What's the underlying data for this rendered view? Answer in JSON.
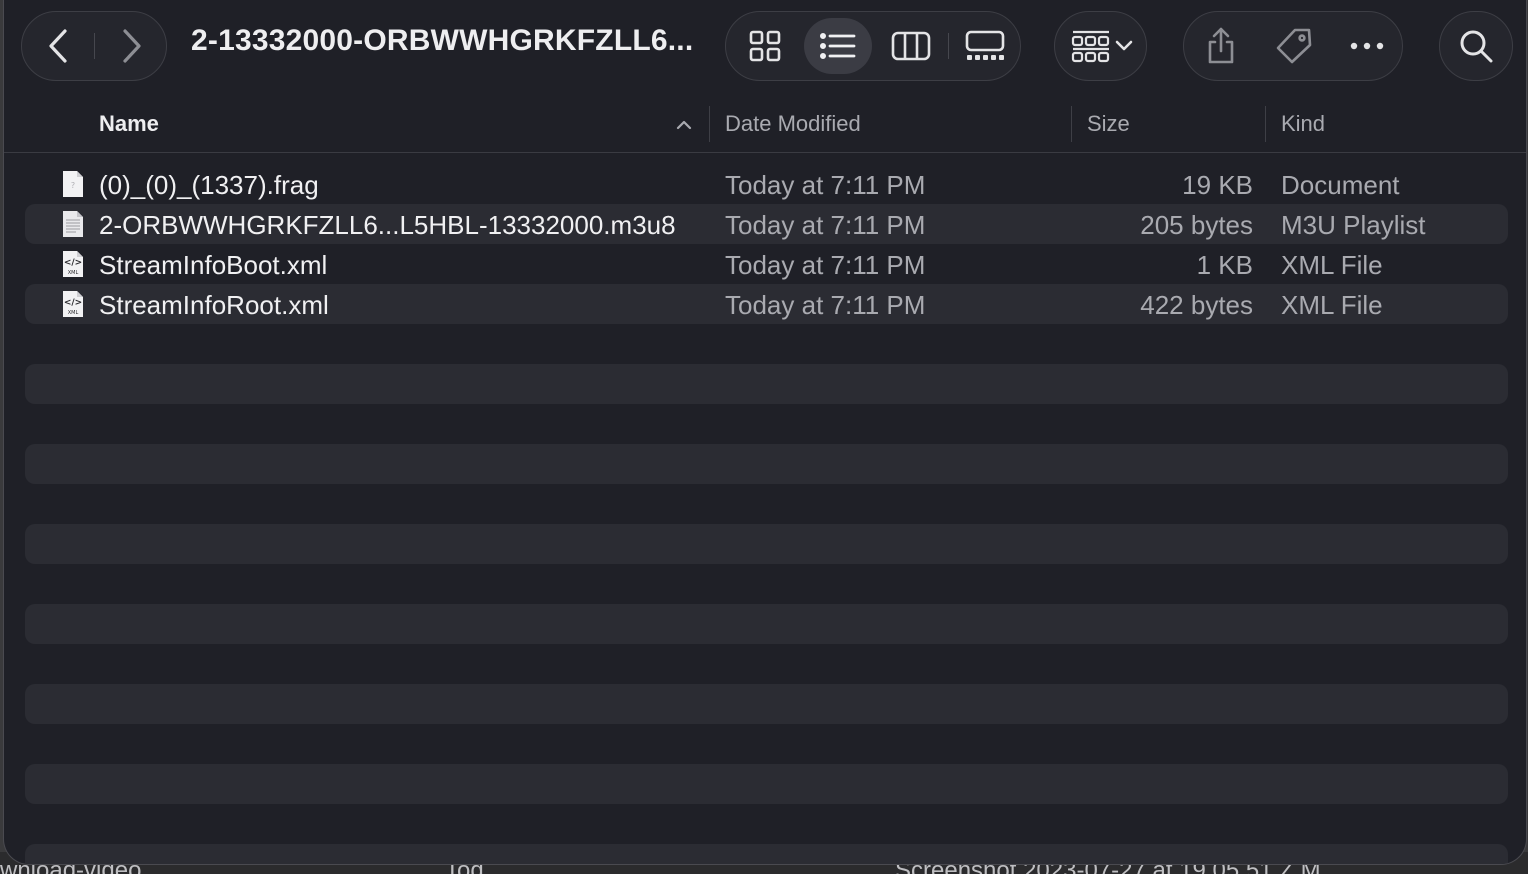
{
  "window": {
    "title": "2-13332000-ORBWWHGRKFZLL6..."
  },
  "toolbar": {
    "back_icon": "chevron-left-icon",
    "forward_icon": "chevron-right-icon",
    "view_modes": [
      "icon-view",
      "list-view",
      "column-view",
      "gallery-view"
    ],
    "active_view": "list-view",
    "group_icon": "group-by-icon",
    "share_icon": "share-icon",
    "tag_icon": "tag-icon",
    "more_icon": "ellipsis-icon",
    "search_icon": "search-icon"
  },
  "columns": {
    "name": "Name",
    "date": "Date Modified",
    "size": "Size",
    "kind": "Kind",
    "sort_indicator": "chevron-up-icon"
  },
  "files": [
    {
      "name": "(0)_(0)_(1337).frag",
      "date": "Today at 7:11 PM",
      "size": "19 KB",
      "kind": "Document",
      "icon": "generic-document-icon"
    },
    {
      "name": "2-ORBWWHGRKFZLL6...L5HBL-13332000.m3u8",
      "date": "Today at 7:11 PM",
      "size": "205 bytes",
      "kind": "M3U Playlist",
      "icon": "text-document-icon"
    },
    {
      "name": "StreamInfoBoot.xml",
      "date": "Today at 7:11 PM",
      "size": "1 KB",
      "kind": "XML File",
      "icon": "xml-file-icon"
    },
    {
      "name": "StreamInfoRoot.xml",
      "date": "Today at 7:11 PM",
      "size": "422 bytes",
      "kind": "XML File",
      "icon": "xml-file-icon"
    }
  ],
  "desktop_peek": {
    "left": "wnload-video",
    "mid": "Tod",
    "right": "Screenshot 2023-07-27 at 19.05.51 Z.M"
  },
  "colors": {
    "window_bg": "#1f2027",
    "row_alt": "#2b2c33",
    "text_primary": "#e6e6e8",
    "text_secondary": "#a9aab0"
  }
}
